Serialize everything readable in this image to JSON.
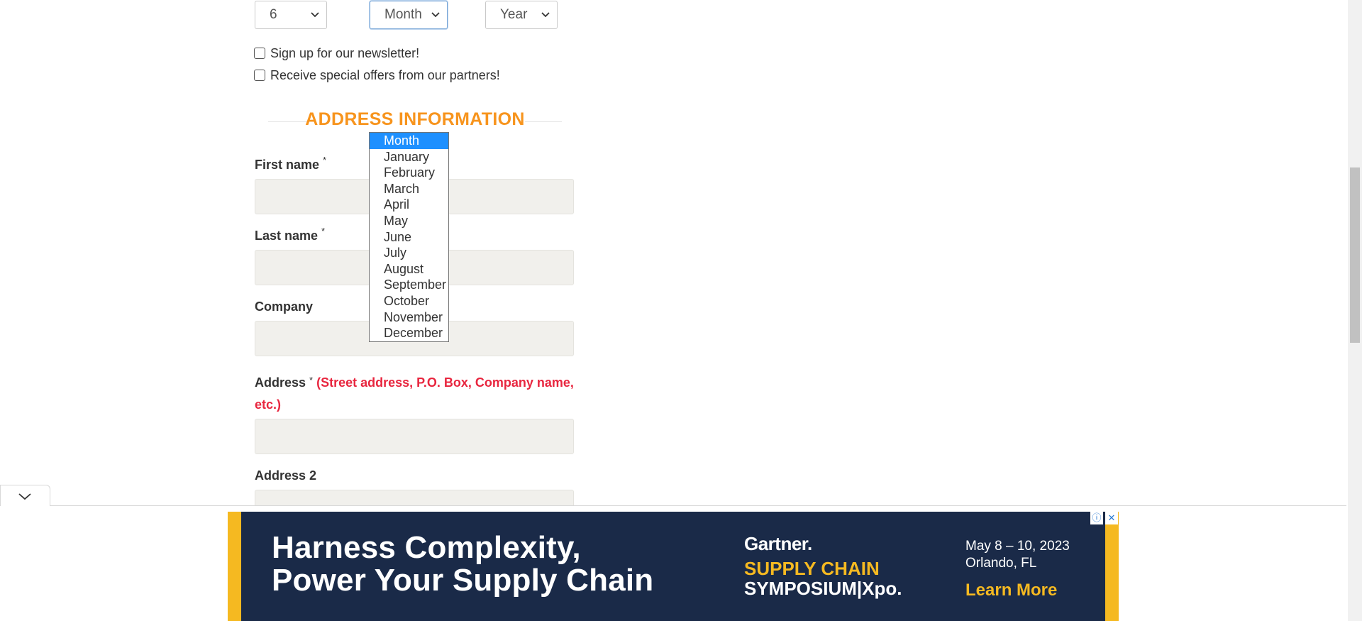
{
  "dob": {
    "day_value": "6",
    "month_value": "Month",
    "year_value": "Year"
  },
  "checkboxes": {
    "newsletter": "Sign up for our newsletter!",
    "offers": "Receive special offers from our partners!"
  },
  "section": {
    "title": "ADDRESS INFORMATION"
  },
  "fields": {
    "first_name": "First name",
    "last_name": "Last name",
    "company": "Company",
    "address": "Address",
    "address_hint": "(Street address, P.O. Box, Company name, etc.)",
    "address2": "Address 2",
    "required_mark": "*"
  },
  "month_dropdown": {
    "options": [
      "Month",
      "January",
      "February",
      "March",
      "April",
      "May",
      "June",
      "July",
      "August",
      "September",
      "October",
      "November",
      "December"
    ],
    "selected": "Month"
  },
  "ad": {
    "headline_1": "Harness Complexity,",
    "headline_2": "Power Your Supply Chain",
    "brand": "Gartner.",
    "event_1": "SUPPLY CHAIN",
    "event_2": "SYMPOSIUM|Xpo.",
    "date": "May 8 – 10, 2023",
    "location": "Orlando, FL",
    "cta": "Learn More",
    "accent_color": "#f5b921",
    "background_color": "#1a2a48"
  },
  "colors": {
    "section_title": "#f7941d",
    "hint": "#e8263f",
    "selected_option": "#1e90ff"
  }
}
